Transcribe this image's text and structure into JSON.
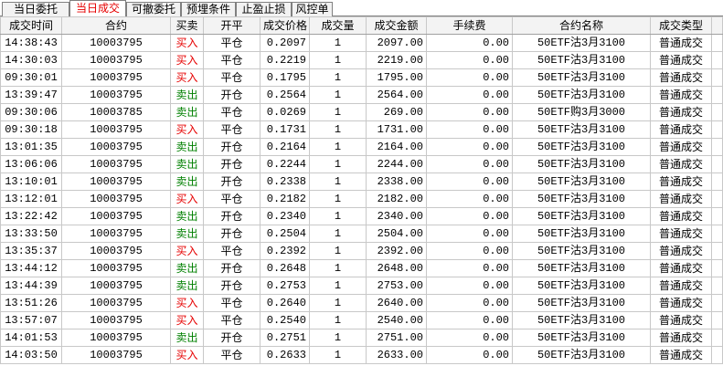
{
  "tabs": [
    {
      "label": "当日委托"
    },
    {
      "label": "当日成交",
      "active": true
    },
    {
      "label": "可撤委托"
    },
    {
      "label": "预埋条件"
    },
    {
      "label": "止盈止损"
    },
    {
      "label": "风控单"
    }
  ],
  "columns": [
    "成交时间",
    "合约",
    "买卖",
    "开平",
    "成交价格",
    "成交量",
    "成交金额",
    "手续费",
    "合约名称",
    "成交类型"
  ],
  "rows": [
    [
      "14:38:43",
      "10003795",
      "买入",
      "平仓",
      "0.2097",
      "1",
      "2097.00",
      "0.00",
      "50ETF沽3月3100",
      "普通成交"
    ],
    [
      "14:30:03",
      "10003795",
      "买入",
      "平仓",
      "0.2219",
      "1",
      "2219.00",
      "0.00",
      "50ETF沽3月3100",
      "普通成交"
    ],
    [
      "09:30:01",
      "10003795",
      "买入",
      "平仓",
      "0.1795",
      "1",
      "1795.00",
      "0.00",
      "50ETF沽3月3100",
      "普通成交"
    ],
    [
      "13:39:47",
      "10003795",
      "卖出",
      "开仓",
      "0.2564",
      "1",
      "2564.00",
      "0.00",
      "50ETF沽3月3100",
      "普通成交"
    ],
    [
      "09:30:06",
      "10003785",
      "卖出",
      "平仓",
      "0.0269",
      "1",
      "269.00",
      "0.00",
      "50ETF购3月3000",
      "普通成交"
    ],
    [
      "09:30:18",
      "10003795",
      "买入",
      "平仓",
      "0.1731",
      "1",
      "1731.00",
      "0.00",
      "50ETF沽3月3100",
      "普通成交"
    ],
    [
      "13:01:35",
      "10003795",
      "卖出",
      "开仓",
      "0.2164",
      "1",
      "2164.00",
      "0.00",
      "50ETF沽3月3100",
      "普通成交"
    ],
    [
      "13:06:06",
      "10003795",
      "卖出",
      "开仓",
      "0.2244",
      "1",
      "2244.00",
      "0.00",
      "50ETF沽3月3100",
      "普通成交"
    ],
    [
      "13:10:01",
      "10003795",
      "卖出",
      "开仓",
      "0.2338",
      "1",
      "2338.00",
      "0.00",
      "50ETF沽3月3100",
      "普通成交"
    ],
    [
      "13:12:01",
      "10003795",
      "买入",
      "平仓",
      "0.2182",
      "1",
      "2182.00",
      "0.00",
      "50ETF沽3月3100",
      "普通成交"
    ],
    [
      "13:22:42",
      "10003795",
      "卖出",
      "开仓",
      "0.2340",
      "1",
      "2340.00",
      "0.00",
      "50ETF沽3月3100",
      "普通成交"
    ],
    [
      "13:33:50",
      "10003795",
      "卖出",
      "开仓",
      "0.2504",
      "1",
      "2504.00",
      "0.00",
      "50ETF沽3月3100",
      "普通成交"
    ],
    [
      "13:35:37",
      "10003795",
      "买入",
      "平仓",
      "0.2392",
      "1",
      "2392.00",
      "0.00",
      "50ETF沽3月3100",
      "普通成交"
    ],
    [
      "13:44:12",
      "10003795",
      "卖出",
      "开仓",
      "0.2648",
      "1",
      "2648.00",
      "0.00",
      "50ETF沽3月3100",
      "普通成交"
    ],
    [
      "13:44:39",
      "10003795",
      "卖出",
      "开仓",
      "0.2753",
      "1",
      "2753.00",
      "0.00",
      "50ETF沽3月3100",
      "普通成交"
    ],
    [
      "13:51:26",
      "10003795",
      "买入",
      "平仓",
      "0.2640",
      "1",
      "2640.00",
      "0.00",
      "50ETF沽3月3100",
      "普通成交"
    ],
    [
      "13:57:07",
      "10003795",
      "买入",
      "平仓",
      "0.2540",
      "1",
      "2540.00",
      "0.00",
      "50ETF沽3月3100",
      "普通成交"
    ],
    [
      "14:01:53",
      "10003795",
      "卖出",
      "开仓",
      "0.2751",
      "1",
      "2751.00",
      "0.00",
      "50ETF沽3月3100",
      "普通成交"
    ],
    [
      "14:03:50",
      "10003795",
      "买入",
      "平仓",
      "0.2633",
      "1",
      "2633.00",
      "0.00",
      "50ETF沽3月3100",
      "普通成交"
    ]
  ],
  "colors": {
    "active_tab_text": "#e60000"
  },
  "side_colors": {
    "买入": "#e60000",
    "卖出": "#008000"
  }
}
